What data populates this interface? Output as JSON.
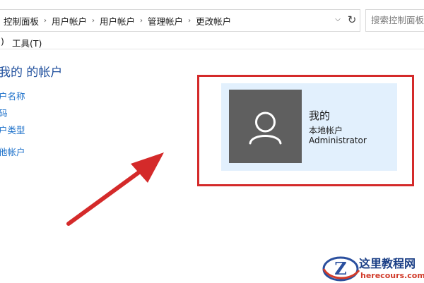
{
  "address_bar": {
    "breadcrumbs": [
      "控制面板",
      "用户帐户",
      "用户帐户",
      "管理帐户",
      "更改帐户"
    ],
    "search_placeholder": "搜索控制面板"
  },
  "menu": {
    "partial_item": ")",
    "tools_label": "工具(T)"
  },
  "left_panel": {
    "heading": "我的 的帐户",
    "links": [
      "户名称",
      "码",
      "户类型",
      "他帐户"
    ]
  },
  "account_card": {
    "name": "我的",
    "type": "本地帐户",
    "role": "Administrator"
  },
  "watermark": {
    "logo_letter": "Z",
    "title": "这里教程网",
    "url": "herecours.com"
  },
  "colors": {
    "annotation_red": "#d42a2a",
    "card_bg": "#e2f0fd",
    "avatar_bg": "#5f5f5f",
    "link_blue": "#1a6fc9",
    "heading_blue": "#1e4e9c"
  }
}
